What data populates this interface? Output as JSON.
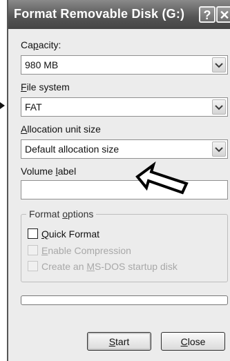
{
  "window": {
    "title": "Format Removable Disk (G:)",
    "help_glyph": "?",
    "close_glyph": "✕"
  },
  "capacity": {
    "prefix": "Ca",
    "mnemonic": "p",
    "suffix": "acity:",
    "value": "980 MB"
  },
  "file_system": {
    "prefix": "",
    "mnemonic": "F",
    "suffix": "ile system",
    "value": "FAT"
  },
  "allocation": {
    "prefix": "",
    "mnemonic": "A",
    "suffix": "llocation unit size",
    "value": "Default allocation size"
  },
  "volume_label": {
    "prefix": "Volume ",
    "mnemonic": "l",
    "suffix": "abel",
    "value": ""
  },
  "format_options": {
    "title_prefix": "Format ",
    "title_mnemonic": "o",
    "title_suffix": "ptions",
    "quick_format": {
      "prefix": "",
      "mnemonic": "Q",
      "suffix": "uick Format",
      "checked": false,
      "enabled": true
    },
    "enable_compression": {
      "prefix": "",
      "mnemonic": "E",
      "suffix": "nable Compression",
      "checked": false,
      "enabled": false
    },
    "msdos_startup": {
      "prefix": "Create an ",
      "mnemonic": "M",
      "suffix": "S-DOS startup disk",
      "checked": false,
      "enabled": false
    }
  },
  "progress": {
    "fraction": 0
  },
  "buttons": {
    "start": {
      "prefix": "",
      "mnemonic": "S",
      "suffix": "tart"
    },
    "close": {
      "prefix": "",
      "mnemonic": "C",
      "suffix": "lose"
    }
  }
}
